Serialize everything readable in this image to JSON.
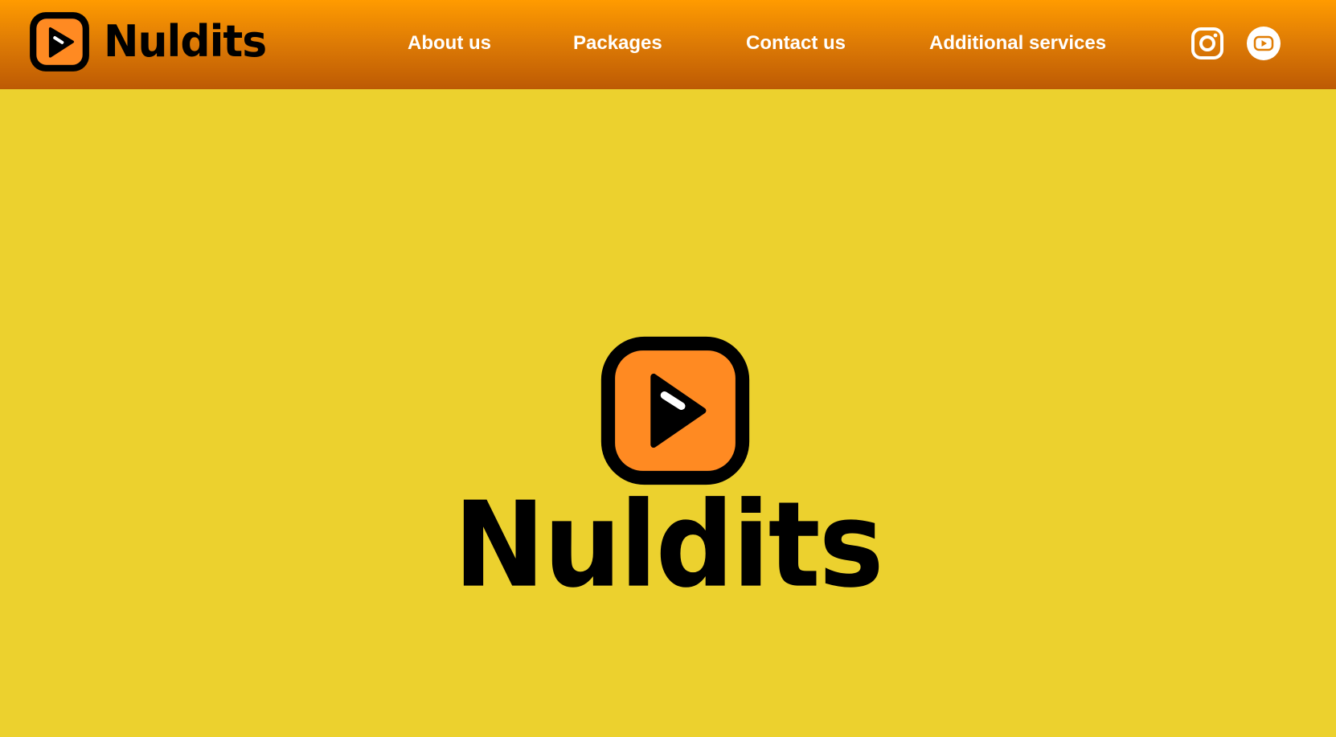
{
  "brand": {
    "name": "Nuldits",
    "logo_icon": "play-logo-icon"
  },
  "nav": {
    "items": [
      {
        "label": "About us"
      },
      {
        "label": "Packages"
      },
      {
        "label": "Contact us"
      },
      {
        "label": "Additional services"
      }
    ]
  },
  "social": {
    "instagram_icon": "instagram-icon",
    "youtube_icon": "youtube-icon"
  },
  "hero": {
    "title": "Nuldits",
    "logo_icon": "play-logo-icon"
  },
  "colors": {
    "header_top": "#FF9B00",
    "header_bottom": "#BD5A04",
    "background": "#ECD12E",
    "logo_orange": "#FF8A22",
    "text_light": "#FFFFFF",
    "text_dark": "#000000"
  }
}
